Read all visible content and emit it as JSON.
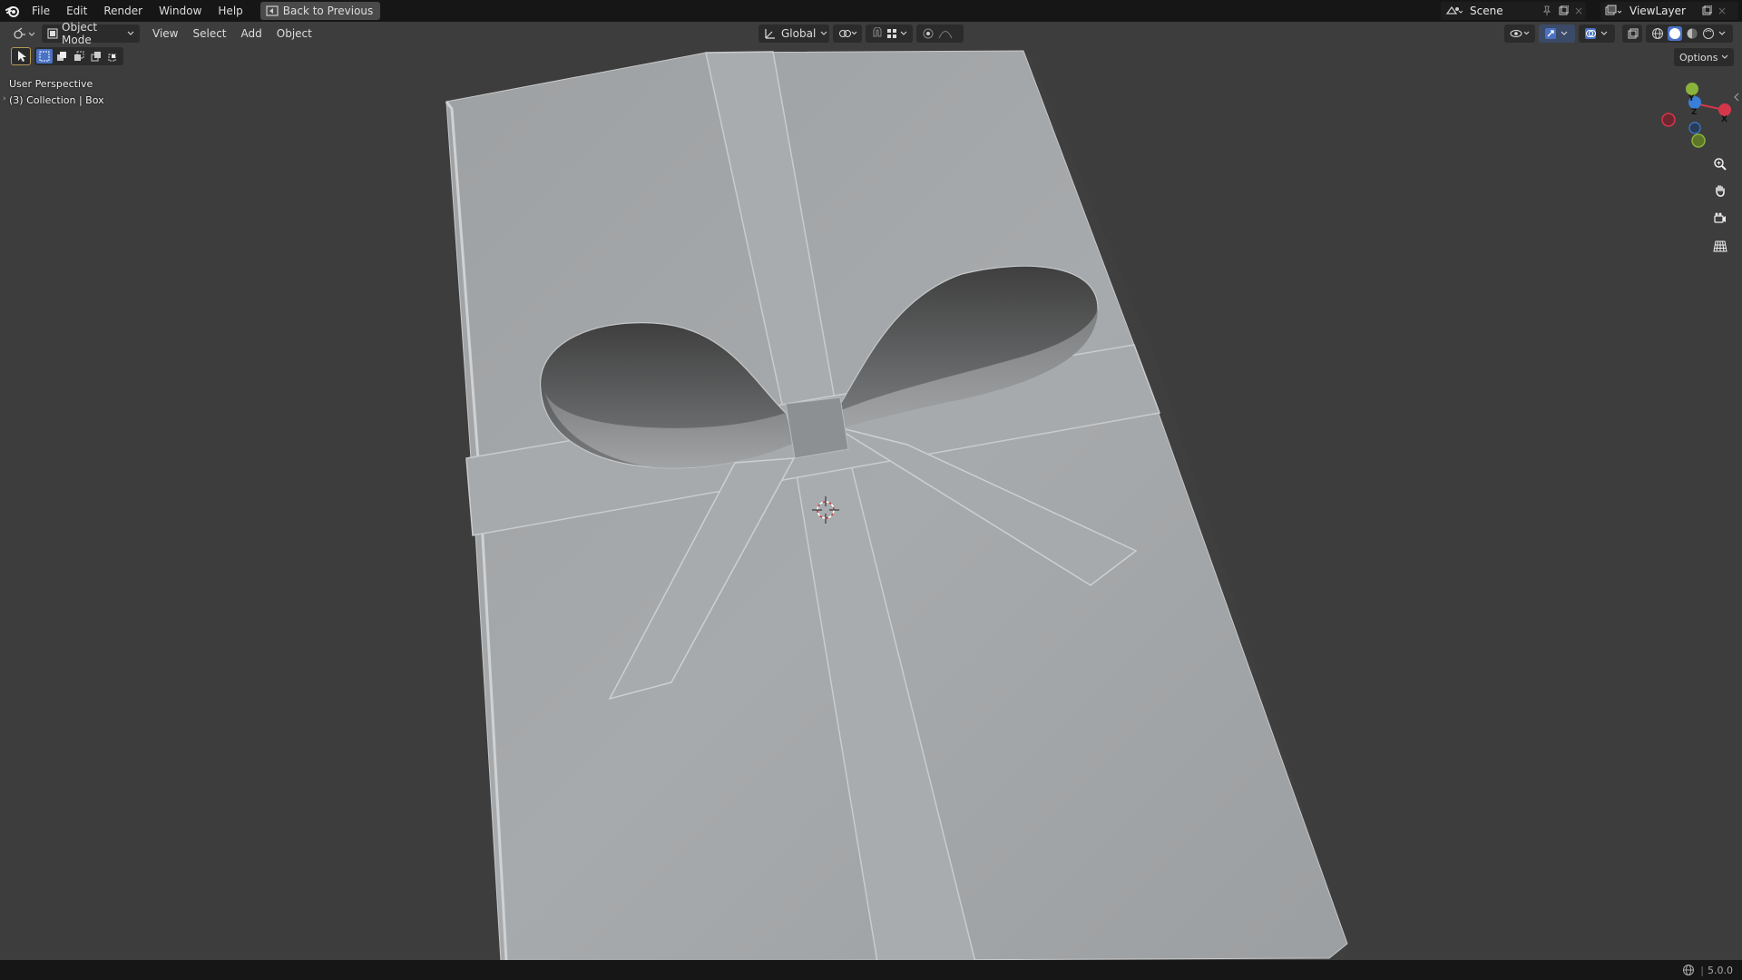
{
  "topbar": {
    "menus": [
      "File",
      "Edit",
      "Render",
      "Window",
      "Help"
    ],
    "back_label": "Back to Previous",
    "scene_label": "Scene",
    "viewlayer_label": "ViewLayer"
  },
  "header": {
    "mode_label": "Object Mode",
    "menus": [
      "View",
      "Select",
      "Add",
      "Object"
    ],
    "orientation_label": "Global",
    "options_label": "Options"
  },
  "viewport": {
    "perspective_label": "User Perspective",
    "collection_label": "(3) Collection | Box"
  },
  "gizmo": {
    "x_label": "X",
    "y_label": "Y",
    "z_label": "Z",
    "x_color": "#d4374a",
    "y_color": "#8bb23a",
    "z_color": "#3a7ed8"
  },
  "status": {
    "version": "5.0.0"
  },
  "colors": {
    "accent": "#4a72c4",
    "background": "#3d3d3d"
  }
}
